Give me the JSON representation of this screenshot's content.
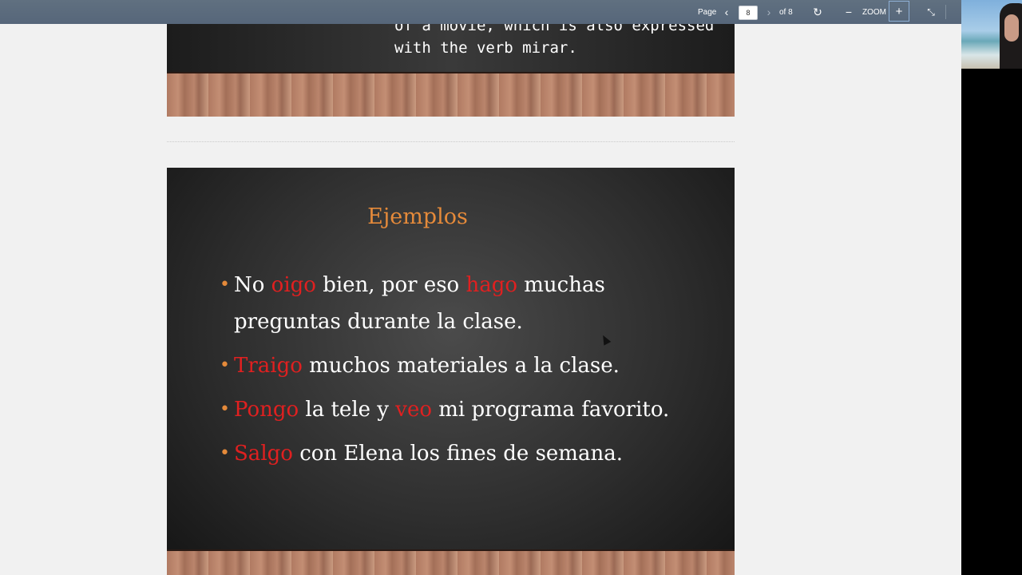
{
  "toolbar": {
    "page_label": "Page",
    "prev_icon": "chevron-left-icon",
    "page_value": "8",
    "next_icon": "chevron-right-icon",
    "of_label": "of 8",
    "rotate_icon": "rotate-icon",
    "zoom_out_icon": "minus-icon",
    "zoom_label": "ZOOM",
    "zoom_in_symbol": "+",
    "collapse_icon": "collapse-icon"
  },
  "previous_slide": {
    "text": "of a movie, which is also expressed with the verb mirar."
  },
  "slide": {
    "title": "Ejemplos",
    "bullets": [
      {
        "parts": [
          {
            "text": "No ",
            "verb": false
          },
          {
            "text": "oigo",
            "verb": true
          },
          {
            "text": " bien, por eso ",
            "verb": false
          },
          {
            "text": "hago",
            "verb": true
          },
          {
            "text": " muchas preguntas durante la clase.",
            "verb": false
          }
        ]
      },
      {
        "parts": [
          {
            "text": "Traigo",
            "verb": true
          },
          {
            "text": " muchos materiales a la clase.",
            "verb": false
          }
        ]
      },
      {
        "parts": [
          {
            "text": "Pongo",
            "verb": true
          },
          {
            "text": " la tele y ",
            "verb": false
          },
          {
            "text": "veo",
            "verb": true
          },
          {
            "text": " mi programa favorito.",
            "verb": false
          }
        ]
      },
      {
        "parts": [
          {
            "text": "Salgo",
            "verb": true
          },
          {
            "text": " con Elena los fines de semana.",
            "verb": false
          }
        ]
      }
    ]
  },
  "colors": {
    "title": "#e58a3a",
    "verb": "#e02020",
    "bullet_dot": "#e58a3a",
    "toolbar": "#5a6a7a"
  }
}
